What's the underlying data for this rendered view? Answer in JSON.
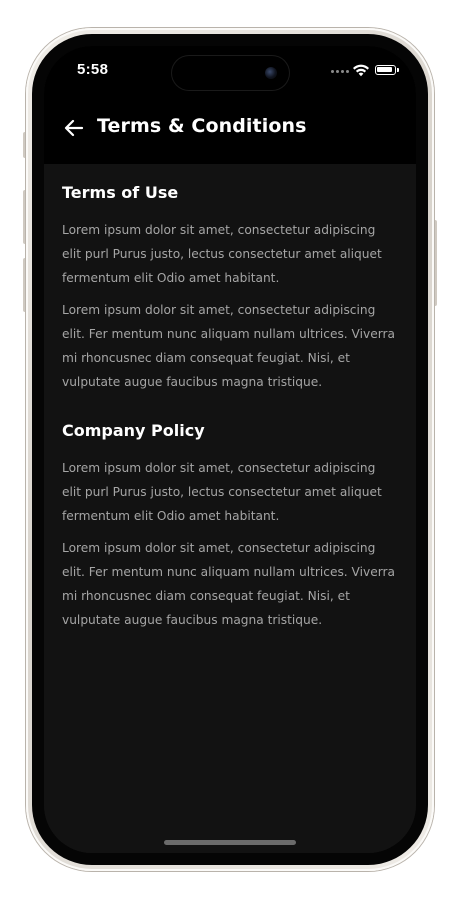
{
  "status_bar": {
    "time": "5:58"
  },
  "header": {
    "title": "Terms & Conditions",
    "back_icon": "arrow-left-icon"
  },
  "sections": [
    {
      "heading": "Terms of Use",
      "paragraphs": [
        "Lorem ipsum dolor sit amet, consectetur adipiscing elit purl Purus justo, lectus consectetur amet aliquet fermentum elit Odio amet habitant.",
        "Lorem ipsum dolor sit amet, consectetur adipiscing elit. Fer mentum nunc aliquam nullam ultrices. Viverra mi rhoncusnec diam consequat feugiat. Nisi, et vulputate augue faucibus magna tristique."
      ]
    },
    {
      "heading": "Company Policy",
      "paragraphs": [
        "Lorem ipsum dolor sit amet, consectetur adipiscing elit purl Purus justo, lectus consectetur amet aliquet fermentum elit Odio amet habitant.",
        "Lorem ipsum dolor sit amet, consectetur adipiscing elit. Fer mentum nunc aliquam nullam ultrices. Viverra mi rhoncusnec diam consequat feugiat. Nisi, et vulputate augue faucibus magna tristique."
      ]
    }
  ],
  "colors": {
    "background": "#121212",
    "header_background": "#000000",
    "heading_text": "#ffffff",
    "body_text": "#a5a5a5"
  }
}
